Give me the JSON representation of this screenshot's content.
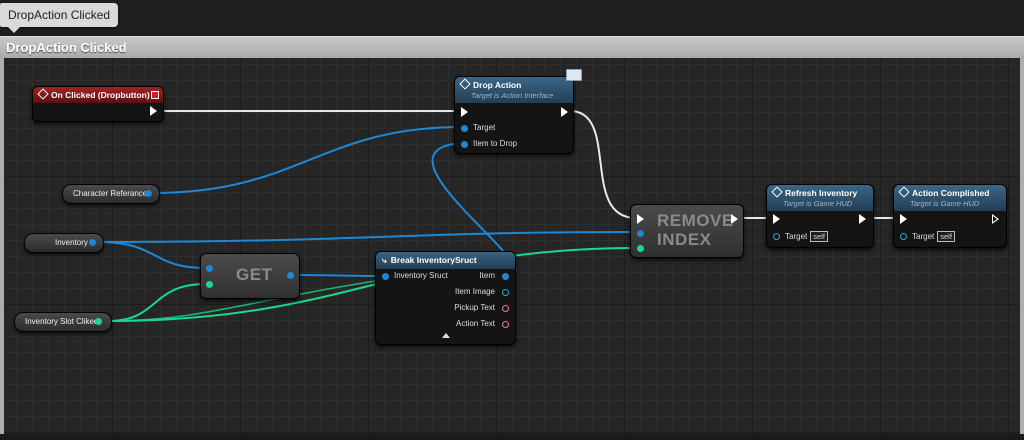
{
  "tab": {
    "label": "DropAction Clicked"
  },
  "comment": {
    "title": "DropAction Clicked"
  },
  "colors": {
    "exec": "#ffffff",
    "object": "#1e88d6",
    "integer": "#19d98c",
    "event_header": "#8a1c1c",
    "function_header": "#2b4a63"
  },
  "nodes": {
    "on_clicked": {
      "title": "On Clicked (Dropbutton)"
    },
    "drop_action": {
      "title": "Drop Action",
      "subtitle": "Target is Action Interface",
      "pin_target": "Target",
      "pin_item": "Item to Drop"
    },
    "character_ref": {
      "label": "Character Referance"
    },
    "inventory": {
      "label": "Inventory"
    },
    "inventory_slot": {
      "label": "Inventory Slot Cliked"
    },
    "get": {
      "title": "GET"
    },
    "break": {
      "title": "Break InventorySruct",
      "in_pin": "Inventory Sruct",
      "out_item": "Item",
      "out_image": "Item Image",
      "out_pickup": "Pickup Text",
      "out_action": "Action Text"
    },
    "remove": {
      "line1": "REMOVE",
      "line2": "INDEX"
    },
    "refresh": {
      "title": "Refresh Inventory",
      "subtitle": "Target is Game HUD",
      "pin_target": "Target",
      "self": "self"
    },
    "action_comp": {
      "title": "Action Complished",
      "subtitle": "Target is Game HUD",
      "pin_target": "Target",
      "self": "self"
    }
  }
}
